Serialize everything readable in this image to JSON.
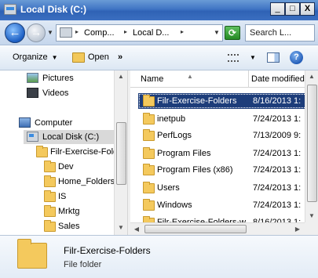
{
  "window": {
    "title": "Local Disk (C:)",
    "min_glyph": "_",
    "max_glyph": "□",
    "close_glyph": "X"
  },
  "address": {
    "crumbs": [
      "Comp...",
      "Local D..."
    ],
    "separator": "▸"
  },
  "search": {
    "placeholder": "Search L..."
  },
  "toolbar": {
    "organize_label": "Organize",
    "open_label": "Open",
    "more_glyph": "»",
    "help_glyph": "?"
  },
  "nav": {
    "items": [
      {
        "label": "Pictures",
        "icon": "pictures-icon"
      },
      {
        "label": "Videos",
        "icon": "videos-icon"
      },
      {
        "label": "Computer",
        "icon": "computer-icon"
      },
      {
        "label": "Local Disk (C:)",
        "icon": "drive-icon",
        "selected": true
      },
      {
        "label": "Filr-Exercise-Folders",
        "icon": "folder-icon"
      },
      {
        "label": "Dev",
        "icon": "folder-icon"
      },
      {
        "label": "Home_Folders",
        "icon": "folder-icon"
      },
      {
        "label": "IS",
        "icon": "folder-icon"
      },
      {
        "label": "Mrktg",
        "icon": "folder-icon"
      },
      {
        "label": "Sales",
        "icon": "folder-icon"
      }
    ]
  },
  "files": {
    "columns": {
      "name": "Name",
      "date": "Date modified"
    },
    "rows": [
      {
        "name": "Filr-Exercise-Folders",
        "date": "8/16/2013 1:",
        "selected": true
      },
      {
        "name": "inetpub",
        "date": "7/24/2013 1:"
      },
      {
        "name": "PerfLogs",
        "date": "7/13/2009 9:"
      },
      {
        "name": "Program Files",
        "date": "7/24/2013 1:"
      },
      {
        "name": "Program Files (x86)",
        "date": "7/24/2013 1:"
      },
      {
        "name": "Users",
        "date": "7/24/2013 1:"
      },
      {
        "name": "Windows",
        "date": "7/24/2013 1:"
      },
      {
        "name": "Filr-Exercise-Folders-w...",
        "date": "8/16/2013 1:"
      }
    ]
  },
  "details": {
    "name": "Filr-Exercise-Folders",
    "type": "File folder"
  }
}
